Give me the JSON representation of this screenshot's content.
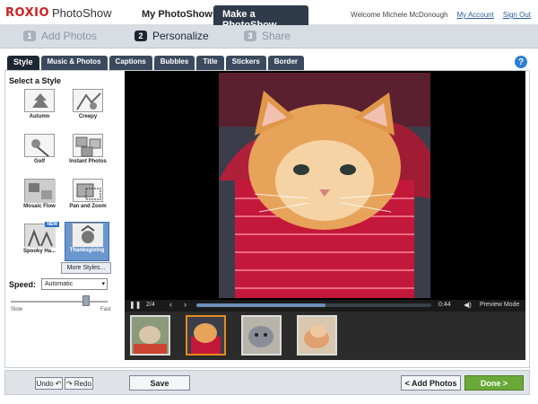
{
  "header": {
    "logo_brand": "ROXIO",
    "logo_product": "PhotoShow",
    "nav": [
      "My PhotoShows",
      "Make a PhotoShow"
    ],
    "welcome": "Welcome Michele McDonough",
    "my_account": "My Account",
    "sign_out": "Sign Out"
  },
  "steps": [
    {
      "num": "1",
      "label": "Add Photos"
    },
    {
      "num": "2",
      "label": "Personalize"
    },
    {
      "num": "3",
      "label": "Share"
    }
  ],
  "tabs": [
    "Style",
    "Music & Photos",
    "Captions",
    "Bubbles",
    "Title",
    "Stickers",
    "Border"
  ],
  "help_icon": "?",
  "left_panel": {
    "title": "Select a Style",
    "styles": [
      "Autumn",
      "Creepy",
      "Golf",
      "Instant Photos",
      "Mosaic Flow",
      "Pan and Zoom",
      "Spooky Ha...",
      "Thanksgiving"
    ],
    "new_badge": "NEW",
    "more_styles": "More Styles...",
    "speed_label": "Speed:",
    "speed_value": "Automatic",
    "speed_position": 0.8,
    "slow": "Slow",
    "fast": "Fast"
  },
  "player": {
    "position": "2/4",
    "time": "0:44",
    "progress": 0.55,
    "preview_mode": "Preview Mode"
  },
  "buttons": {
    "undo": "Undo",
    "redo": "Redo",
    "save": "Save",
    "add_photos": "< Add Photos",
    "done": "Done >"
  },
  "colors": {
    "header_dark": "#2f3a4a",
    "accent_blue": "#2a7fd4",
    "done_green": "#6aa83a",
    "thumb_selected": "#e58a1c"
  }
}
